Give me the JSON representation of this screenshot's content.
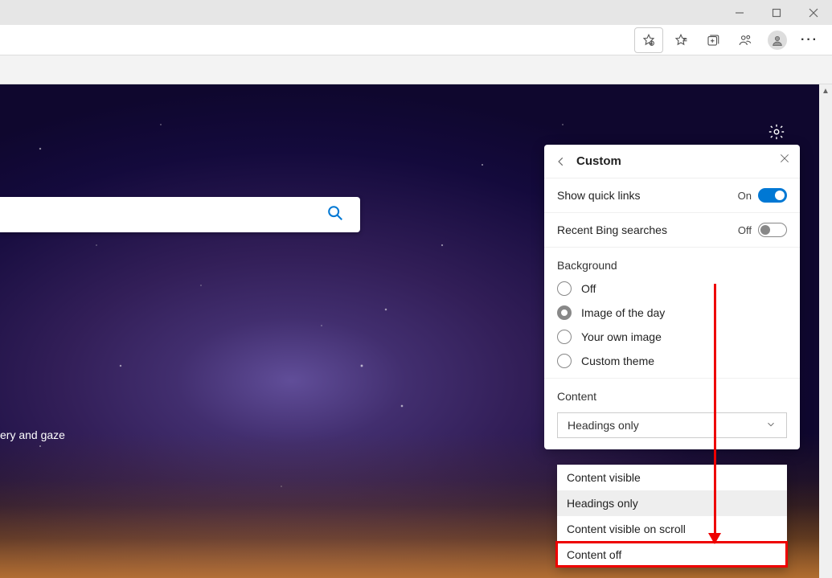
{
  "window_controls": {
    "minimize": "",
    "maximize": "",
    "close": ""
  },
  "caption_text": "ery and gaze",
  "panel": {
    "title": "Custom",
    "quick_links_label": "Show quick links",
    "quick_links_state": "On",
    "bing_label": "Recent Bing searches",
    "bing_state": "Off",
    "background_label": "Background",
    "bg_options": {
      "off": "Off",
      "image_day": "Image of the day",
      "own_image": "Your own image",
      "custom_theme": "Custom theme"
    },
    "content_label": "Content",
    "content_selected": "Headings only",
    "content_options": {
      "visible": "Content visible",
      "headings": "Headings only",
      "scroll": "Content visible on scroll",
      "off": "Content off"
    }
  }
}
